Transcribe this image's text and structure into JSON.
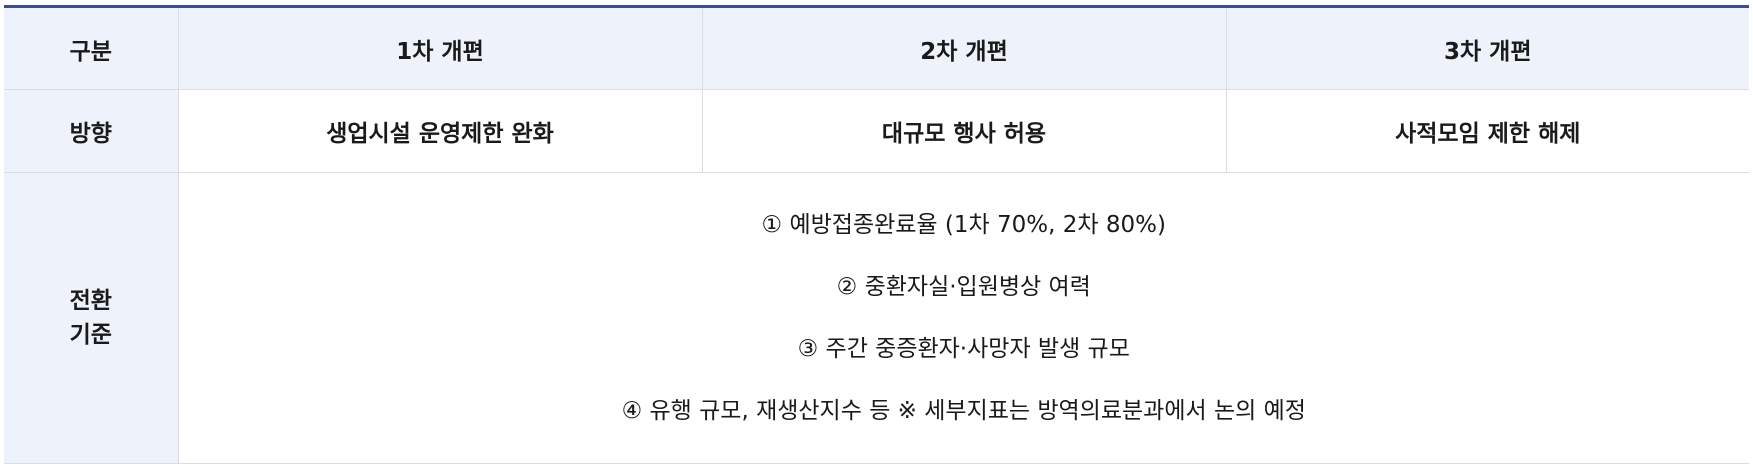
{
  "table": {
    "header": {
      "label": "구분",
      "columns": [
        "1차 개편",
        "2차 개편",
        "3차 개편"
      ]
    },
    "direction": {
      "label": "방향",
      "values": [
        "생업시설 운영제한 완화",
        "대규모 행사 허용",
        "사적모임 제한 해제"
      ]
    },
    "criteria": {
      "label_line1": "전환",
      "label_line2": "기준",
      "items": [
        "① 예방접종완료율 (1차 70%, 2차 80%)",
        "② 중환자실·입원병상 여력",
        "③ 주간 중증환자·사망자 발생 규모",
        "④ 유행 규모, 재생산지수 등 ※ 세부지표는 방역의료분과에서 논의 예정"
      ]
    }
  },
  "colors": {
    "top_rule": "#3b4d8c",
    "header_bg": "#eef3fb",
    "border": "#d9dde6"
  }
}
